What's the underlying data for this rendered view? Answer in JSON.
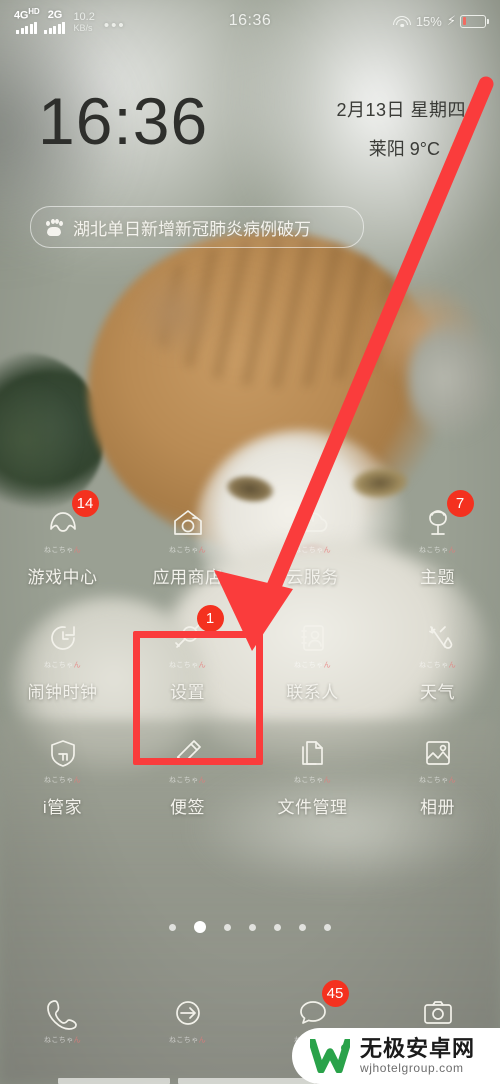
{
  "status_bar": {
    "signal1_label": "4G",
    "signal1_sup": "HD",
    "signal2_label": "2G",
    "net_speed_value": "10.2",
    "net_speed_unit": "KB/s",
    "overflow_dots": "•••",
    "time": "16:36",
    "wifi_icon": "wifi-icon",
    "battery_percent": "15%",
    "battery_level": 15,
    "charging_icon": "lightning-bolt-icon",
    "battery_color": "#f26b61"
  },
  "clock_widget": {
    "time": "16:36",
    "date": "2月13日 星期四",
    "weather": "莱阳 9°C",
    "weather_icon": "sun-icon"
  },
  "news_banner": {
    "icon": "baidu-paw-icon",
    "text": "湖北单日新增新冠肺炎病例破万"
  },
  "app_grid": {
    "rows": [
      [
        {
          "label": "游戏中心",
          "icon": "game-center-icon",
          "sub": "ねこちゃん",
          "badge": "14"
        },
        {
          "label": "应用商店",
          "icon": "app-store-house-icon",
          "sub": "ねこちゃん",
          "badge": ""
        },
        {
          "label": "云服务",
          "icon": "cloud-icon",
          "sub": "ねこちゃん",
          "badge": ""
        },
        {
          "label": "主题",
          "icon": "theme-flower-icon",
          "sub": "ねこちゃん",
          "badge": "7"
        }
      ],
      [
        {
          "label": "闹钟时钟",
          "icon": "clock-icon",
          "sub": "ねこちゃん",
          "badge": ""
        },
        {
          "label": "设置",
          "icon": "settings-wrench-icon",
          "sub": "ねこちゃん",
          "badge": "1"
        },
        {
          "label": "联系人",
          "icon": "contacts-icon",
          "sub": "ねこちゃん",
          "badge": ""
        },
        {
          "label": "天气",
          "icon": "weather-icon",
          "sub": "ねこちゃん",
          "badge": ""
        }
      ],
      [
        {
          "label": "i管家",
          "icon": "shield-manager-icon",
          "sub": "ねこちゃん",
          "badge": ""
        },
        {
          "label": "便签",
          "icon": "notes-pencil-icon",
          "sub": "ねこちゃん",
          "badge": ""
        },
        {
          "label": "文件管理",
          "icon": "file-manager-icon",
          "sub": "ねこちゃん",
          "badge": ""
        },
        {
          "label": "相册",
          "icon": "gallery-icon",
          "sub": "ねこちゃん",
          "badge": ""
        }
      ]
    ]
  },
  "page_indicator": {
    "total": 7,
    "active_index": 1
  },
  "dock": {
    "items": [
      {
        "label": "",
        "icon": "phone-icon",
        "sub": "ねこちゃん",
        "badge": ""
      },
      {
        "label": "",
        "icon": "browser-arrow-icon",
        "sub": "ねこちゃん",
        "badge": ""
      },
      {
        "label": "",
        "icon": "messages-icon",
        "sub": "ねこちゃん",
        "badge": "45"
      },
      {
        "label": "",
        "icon": "camera-icon",
        "sub": "",
        "badge": ""
      }
    ]
  },
  "annotations": {
    "arrow_color": "#fa3c3c",
    "highlight_box_color": "#fa3c3c",
    "highlight_target": "设置"
  },
  "watermark": {
    "cn": "无极安卓网",
    "en": "wjhotelgroup.com",
    "logo_color": "#2aa24a"
  }
}
